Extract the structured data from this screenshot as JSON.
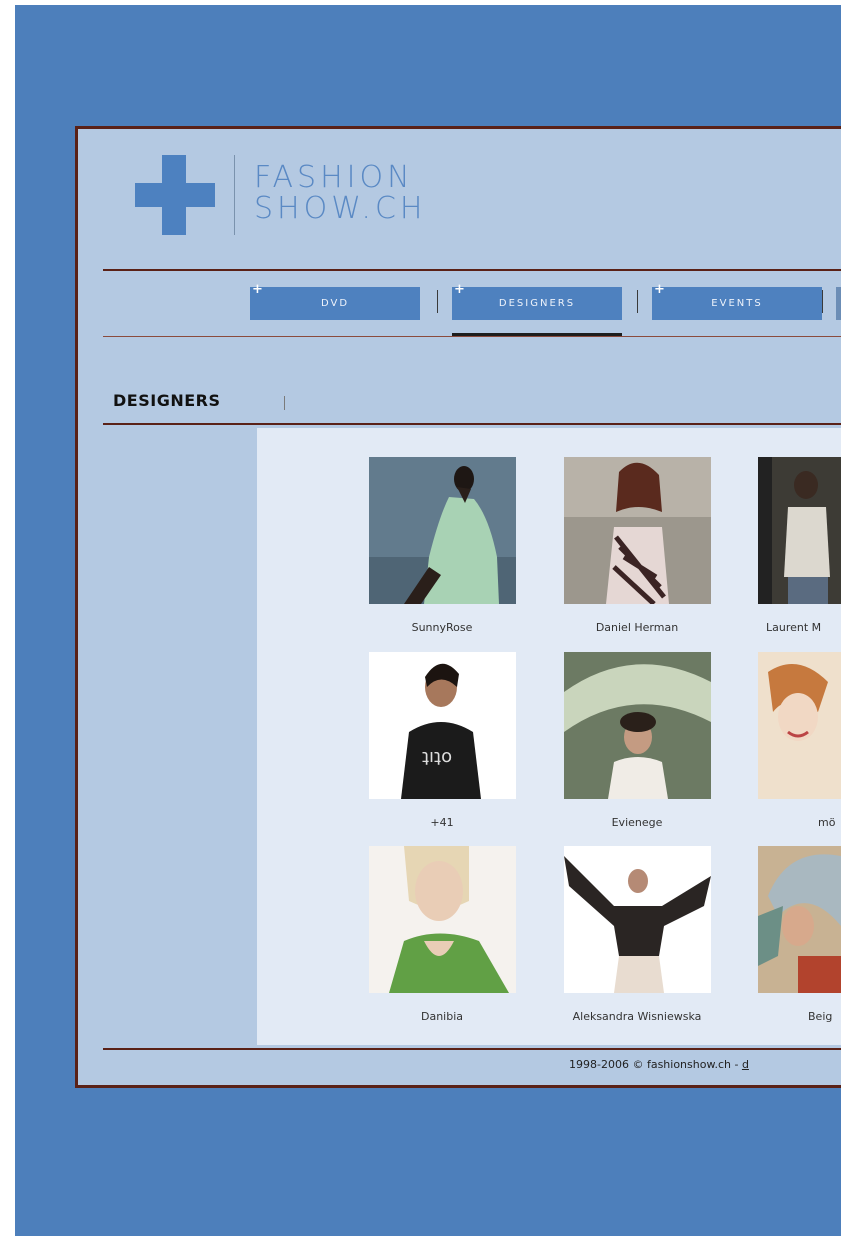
{
  "logo": {
    "line1": "FASHION",
    "line2": "SHOW.CH",
    "color": "#4d81c0"
  },
  "nav": {
    "items": [
      {
        "label": "DVD"
      },
      {
        "label": "DESIGNERS",
        "active": true
      },
      {
        "label": "EVENTS"
      }
    ],
    "plus_glyph": "+"
  },
  "section": {
    "title": "DESIGNERS"
  },
  "designers": [
    {
      "name": "SunnyRose",
      "icon": "photo-model-icon"
    },
    {
      "name": "Daniel Herman",
      "icon": "photo-model-icon"
    },
    {
      "name": "Laurent M",
      "icon": "photo-model-icon"
    },
    {
      "name": "+41",
      "icon": "photo-model-icon"
    },
    {
      "name": "Evienege",
      "icon": "photo-model-icon"
    },
    {
      "name": "mö",
      "icon": "photo-model-icon"
    },
    {
      "name": "Danibia",
      "icon": "photo-model-icon"
    },
    {
      "name": "Aleksandra Wisniewska",
      "icon": "photo-model-icon"
    },
    {
      "name": "Beig",
      "icon": "photo-model-icon"
    }
  ],
  "footer": {
    "text": "1998-2006 © fashionshow.ch - ",
    "link": "d"
  },
  "colors": {
    "background": "#4d7fbb",
    "frame": "#b4c9e2",
    "border": "#5a2117",
    "nav_button": "#4e81bf",
    "content": "#e2eaf5"
  }
}
